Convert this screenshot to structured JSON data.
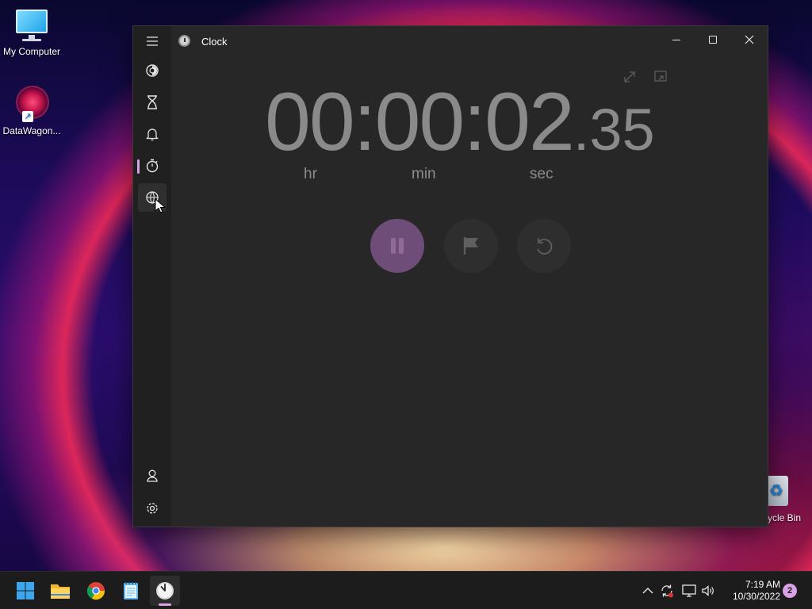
{
  "desktop": {
    "icons": [
      {
        "label": "My Computer"
      },
      {
        "label": "DataWagon..."
      },
      {
        "label": "cycle Bin"
      }
    ]
  },
  "window": {
    "title": "Clock",
    "nav_items": [
      "focus-sessions-icon",
      "timer-icon",
      "alarm-icon",
      "stopwatch-icon",
      "world-clock-icon"
    ],
    "nav_bottom": [
      "account-icon",
      "settings-icon"
    ],
    "selected_nav": "stopwatch-icon"
  },
  "stopwatch": {
    "time_main": "00:00:02",
    "time_frac": ".35",
    "units": {
      "hr": "hr",
      "min": "min",
      "sec": "sec"
    },
    "running": true
  },
  "taskbar": {
    "apps": [
      "start-icon",
      "file-explorer-icon",
      "chrome-icon",
      "notepad-icon",
      "clock-app-icon"
    ],
    "active_app": "clock-app-icon",
    "time": "7:19 AM",
    "date": "10/30/2022",
    "notification_count": "2"
  },
  "colors": {
    "accent": "#d9a2e6",
    "pause_button": "#6e4e78",
    "window_bg": "#272727",
    "rail_bg": "#202020",
    "taskbar_bg": "#1c1c1c"
  }
}
